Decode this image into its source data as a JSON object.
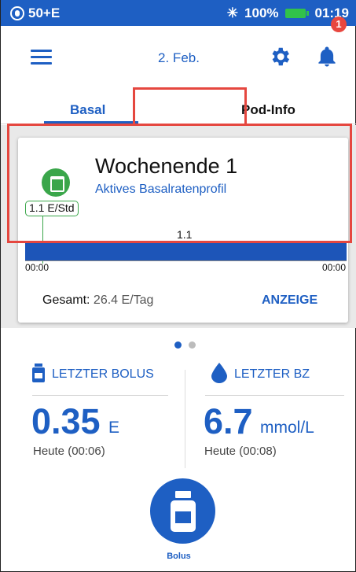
{
  "status_bar": {
    "pod_label": "50+E",
    "battery_pct": "100%",
    "time": "01:19",
    "icons": [
      "pod-icon",
      "bluetooth-icon",
      "battery-icon"
    ],
    "color": "#1e5fc3"
  },
  "header": {
    "date": "2. Feb.",
    "notification_count": "1",
    "icons": [
      "menu-icon",
      "gear-icon",
      "bell-icon"
    ]
  },
  "tabs": [
    {
      "label": "Basal"
    },
    {
      "label": "Pod-Info"
    }
  ],
  "basal_card": {
    "profile_name": "Wochenende 1",
    "profile_status": "Aktives Basalratenprofil",
    "current_rate_tag": "1.1 E/Std",
    "bar_value": "1.1",
    "axis_start": "00:00",
    "axis_end": "00:00",
    "total_label": "Gesamt:",
    "total_value": "26.4 E/Tag",
    "view_button": "ANZEIGE"
  },
  "pager": {
    "active_page": 1,
    "total_pages": 2
  },
  "last_bolus": {
    "title": "LETZTER BOLUS",
    "value": "0.35",
    "unit": "E",
    "time": "Heute (00:06)"
  },
  "last_bg": {
    "title": "LETZTER BZ",
    "value": "6.7",
    "unit": "mmol/L",
    "time": "Heute (00:08)"
  },
  "bolus_button": {
    "label": "Bolus"
  },
  "colors": {
    "primary": "#1e5fc3",
    "success": "#3aa64a",
    "highlight": "#e5473f",
    "badge": "#e8473f"
  }
}
